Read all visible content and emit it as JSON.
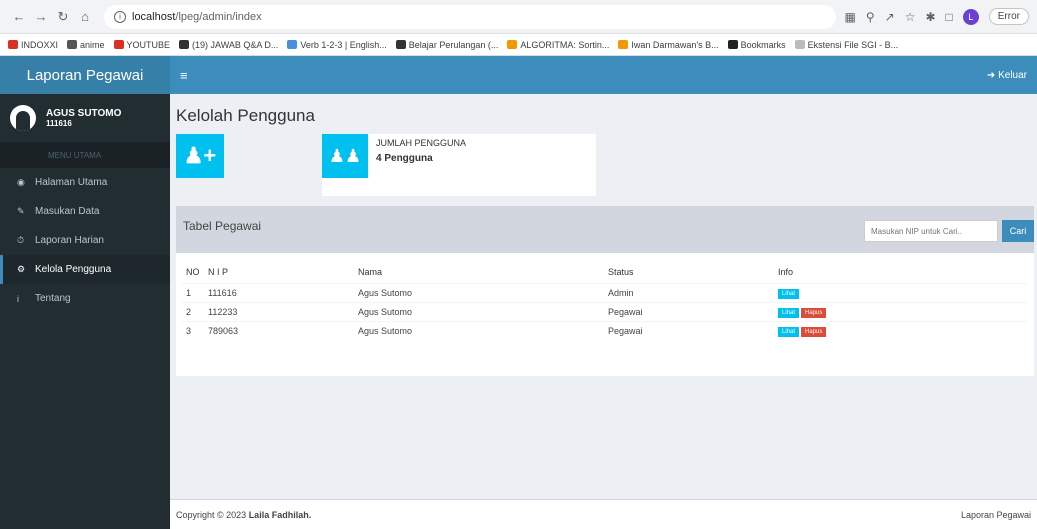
{
  "browser": {
    "url_host": "localhost",
    "url_path": "/lpeg/admin/index",
    "profile_letter": "L",
    "error_label": "Error",
    "bookmarks": [
      {
        "label": "INDOXXI",
        "color": "#d93025"
      },
      {
        "label": "anime",
        "color": "#555555"
      },
      {
        "label": "YOUTUBE",
        "color": "#d93025"
      },
      {
        "label": "(19) JAWAB Q&A D...",
        "color": "#333333"
      },
      {
        "label": "Verb 1-2-3 | English...",
        "color": "#4a90d9"
      },
      {
        "label": "Belajar Perulangan (...",
        "color": "#333333"
      },
      {
        "label": "ALGORITMA: Sortin...",
        "color": "#f29900"
      },
      {
        "label": "Iwan Darmawan's B...",
        "color": "#f29900"
      },
      {
        "label": "Bookmarks",
        "color": "#202124"
      },
      {
        "label": "Ekstensi File SGI - B...",
        "color": "#bbbbbb"
      }
    ]
  },
  "app": {
    "logo": "Laporan Pegawai",
    "logout_label": "Keluar"
  },
  "user": {
    "name": "AGUS SUTOMO",
    "id": "111616"
  },
  "sidebar": {
    "header": "MENU UTAMA",
    "items": [
      {
        "label": "Halaman Utama",
        "icon": "dashboard-icon"
      },
      {
        "label": "Masukan Data",
        "icon": "edit-icon"
      },
      {
        "label": "Laporan Harian",
        "icon": "history-icon"
      },
      {
        "label": "Kelola Pengguna",
        "icon": "cogs-icon",
        "active": true
      },
      {
        "label": "Tentang",
        "icon": "info-icon"
      }
    ]
  },
  "page": {
    "title": "Kelolah Pengguna"
  },
  "info_box": {
    "label": "JUMLAH PENGGUNA",
    "value": "4 Pengguna"
  },
  "table": {
    "title": "Tabel Pegawai",
    "search_placeholder": "Masukan NIP untuk Cari..",
    "search_button": "Cari",
    "headers": [
      "NO",
      "N I P",
      "Nama",
      "Status",
      "Info"
    ],
    "view_label": "Lihat",
    "delete_label": "Hapus",
    "rows": [
      {
        "no": "1",
        "nip": "111616",
        "nama": "Agus Sutomo",
        "status": "Admin",
        "can_delete": false
      },
      {
        "no": "2",
        "nip": "112233",
        "nama": "Agus Sutomo",
        "status": "Pegawai",
        "can_delete": true
      },
      {
        "no": "3",
        "nip": "789063",
        "nama": "Agus Sutomo",
        "status": "Pegawai",
        "can_delete": true
      }
    ]
  },
  "footer": {
    "copyright_prefix": "Copyright © 2023",
    "author": "Laila Fadhilah.",
    "right": "Laporan Pegawai"
  },
  "colors": {
    "primary": "#3c8dbc",
    "info": "#00c0ef",
    "danger": "#dd4b39",
    "sidebar": "#222d32"
  }
}
